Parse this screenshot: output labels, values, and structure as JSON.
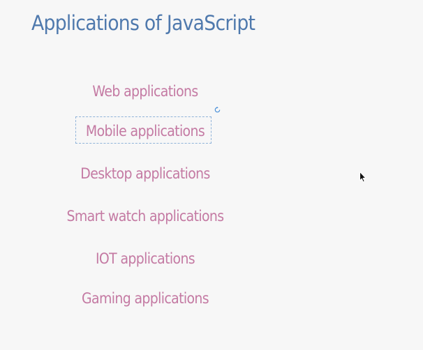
{
  "slide": {
    "title": "Applications of JavaScript",
    "items": [
      "Web applications",
      "Mobile applications",
      "Desktop applications",
      "Smart watch applications",
      "IOT applications",
      "Gaming applications"
    ],
    "selected_item_index": 1
  },
  "colors": {
    "title": "#4f79ad",
    "items": "#c47aa3",
    "background": "#f7f7f7",
    "selection": "#8fb3d9"
  },
  "icons": {
    "rotate_handle": "rotate-icon",
    "cursor": "mouse-pointer-icon"
  }
}
